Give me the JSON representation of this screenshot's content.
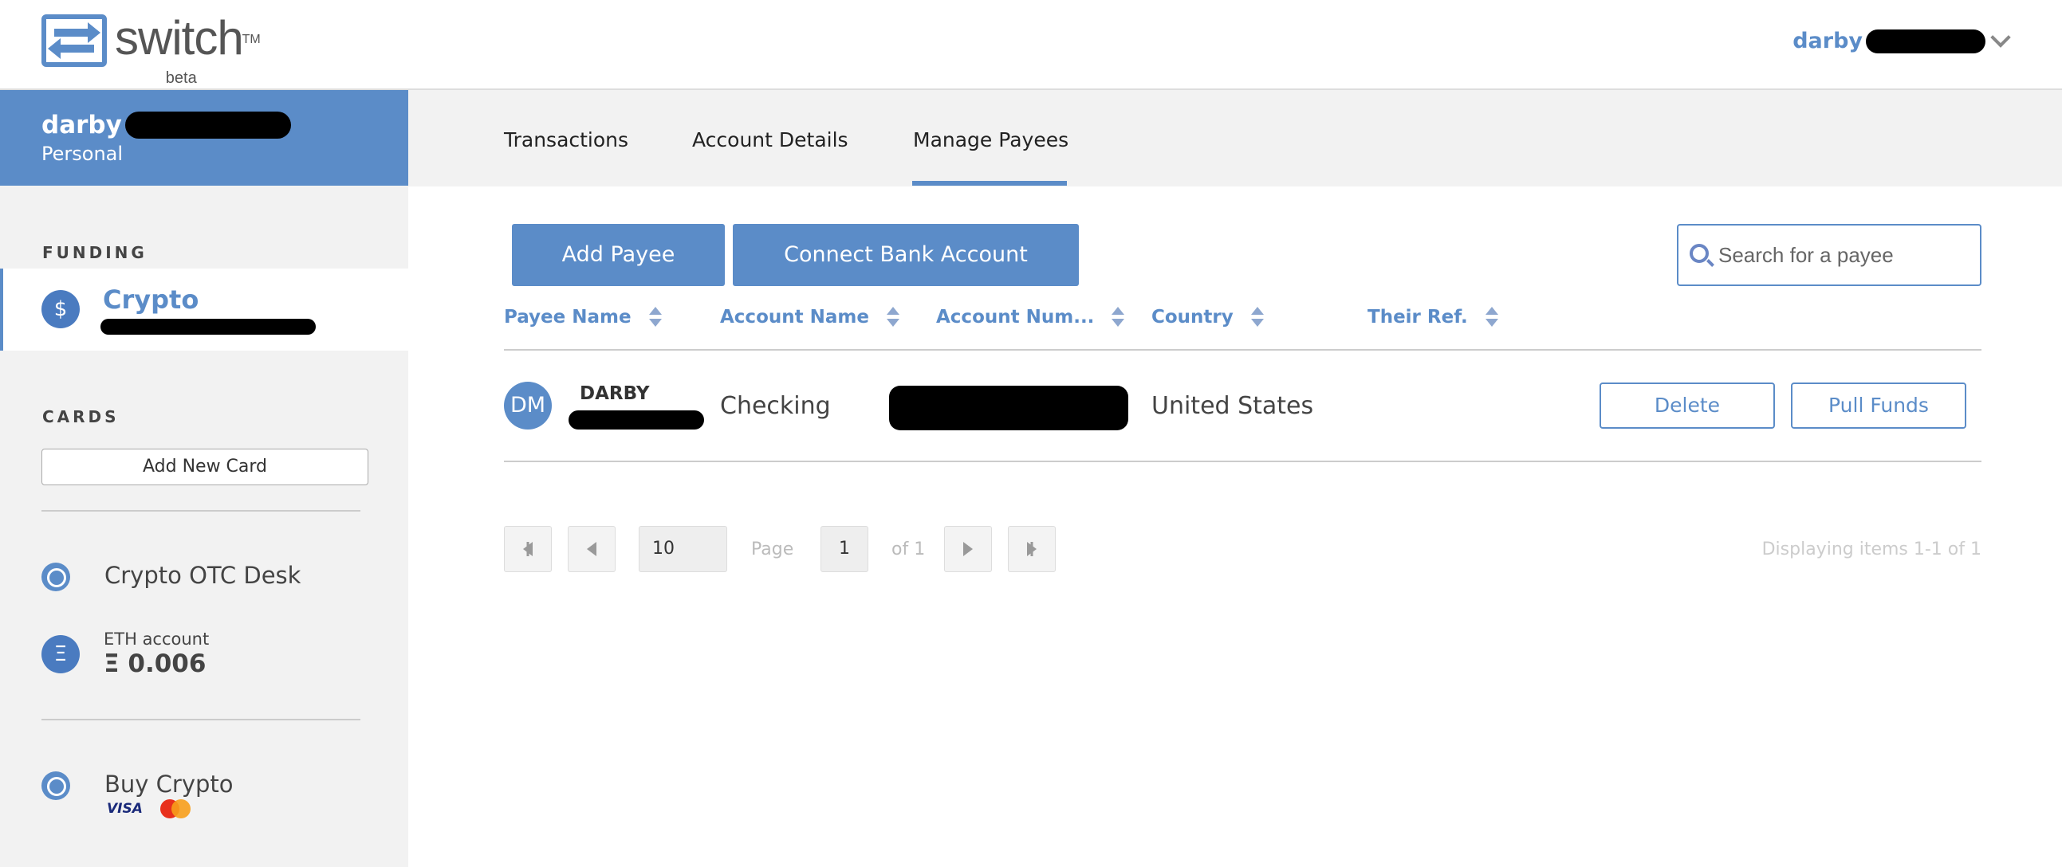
{
  "header": {
    "logo_text": "switch",
    "logo_tm": "TM",
    "logo_beta": "beta",
    "user_name": "darby"
  },
  "sidebar": {
    "account_name": "darby",
    "account_type": "Personal",
    "funding_label": "FUNDING",
    "crypto_title": "Crypto",
    "crypto_icon": "$",
    "cards_label": "CARDS",
    "add_card": "Add New Card",
    "otc_label": "Crypto OTC Desk",
    "eth_label": "ETH account",
    "eth_icon": "Ξ",
    "eth_value": "Ξ 0.006",
    "buy_label": "Buy Crypto",
    "visa_text": "VISA"
  },
  "tabs": [
    {
      "label": "Transactions",
      "active": false
    },
    {
      "label": "Account Details",
      "active": false
    },
    {
      "label": "Manage Payees",
      "active": true
    }
  ],
  "actions": {
    "add_payee": "Add Payee",
    "connect_bank": "Connect Bank Account",
    "search_placeholder": "Search for a payee"
  },
  "table": {
    "columns": [
      "Payee Name",
      "Account Name",
      "Account Num...",
      "Country",
      "Their Ref."
    ],
    "rows": [
      {
        "initials": "DM",
        "payee_name": "DARBY",
        "account_name": "Checking",
        "country": "United States",
        "delete_label": "Delete",
        "pull_label": "Pull Funds"
      }
    ]
  },
  "pager": {
    "page_size": "10",
    "page_label": "Page",
    "page": "1",
    "of_label": "of 1",
    "info": "Displaying items 1-1 of 1"
  },
  "colors": {
    "accent": "#5b8cc8",
    "sidebar_bg": "#f2f2f2"
  }
}
